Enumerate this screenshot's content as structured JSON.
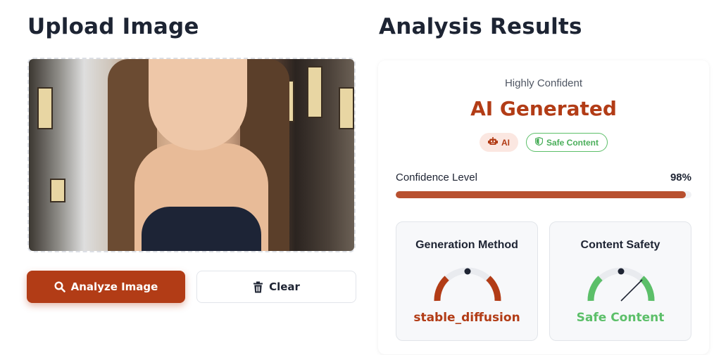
{
  "upload": {
    "title": "Upload Image",
    "analyze_label": "Analyze Image",
    "clear_label": "Clear"
  },
  "results": {
    "title": "Analysis Results",
    "confidence_text": "Highly Confident",
    "verdict": "AI Generated",
    "badges": [
      {
        "label": "AI",
        "icon": "robot-icon",
        "color": "#b23c16"
      },
      {
        "label": "Safe Content",
        "icon": "shield-icon",
        "color": "#4aae5a"
      }
    ],
    "confidence": {
      "label": "Confidence Level",
      "value_text": "98%",
      "value": 0.98
    },
    "generation_method": {
      "title": "Generation Method",
      "value": "stable_diffusion",
      "color": "#b23c16"
    },
    "content_safety": {
      "title": "Content Safety",
      "value": "Safe Content",
      "color": "#5cbf69"
    }
  }
}
